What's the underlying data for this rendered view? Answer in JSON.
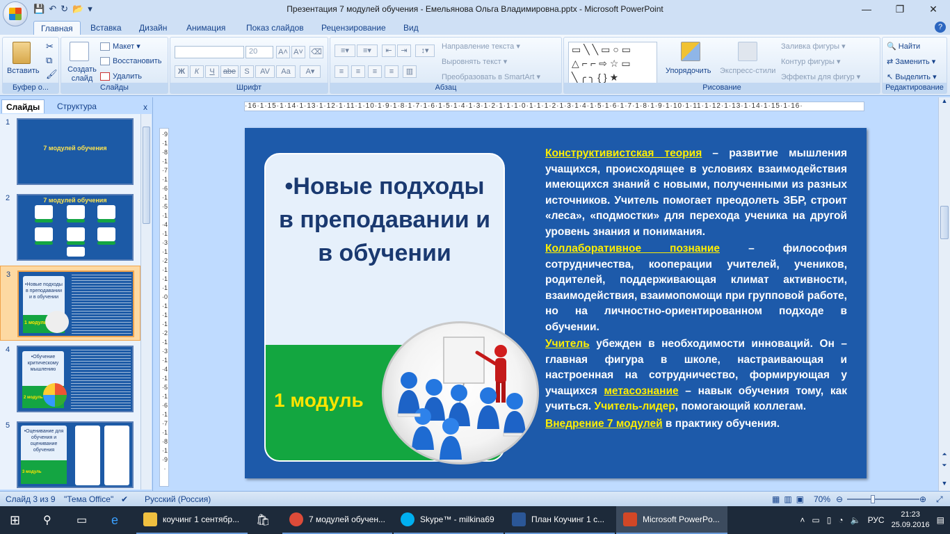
{
  "window": {
    "title": "Презентация 7 модулей обучения - Емельянова Ольга Владимировна.pptx - Microsoft PowerPoint",
    "minimize": "—",
    "maximize": "❐",
    "close": "✕"
  },
  "ribbon_tabs": [
    "Главная",
    "Вставка",
    "Дизайн",
    "Анимация",
    "Показ слайдов",
    "Рецензирование",
    "Вид"
  ],
  "ribbon": {
    "clipboard": {
      "paste": "Вставить",
      "label": "Буфер о..."
    },
    "slides": {
      "new_slide": "Создать слайд",
      "layout": "Макет",
      "reset": "Восстановить",
      "delete": "Удалить",
      "label": "Слайды"
    },
    "font": {
      "font_size": "20",
      "bold": "Ж",
      "italic": "К",
      "underline": "Ч",
      "strike": "abe",
      "shadow": "S",
      "spacing": "AV",
      "case": "Aa",
      "label": "Шрифт"
    },
    "paragraph": {
      "text_direction": "Направление текста",
      "align_text": "Выровнять текст",
      "smartart": "Преобразовать в SmartArt",
      "label": "Абзац"
    },
    "drawing": {
      "arrange": "Упорядочить",
      "quick_styles": "Экспресс-стили",
      "fill": "Заливка фигуры",
      "outline": "Контур фигуры",
      "effects": "Эффекты для фигур",
      "label": "Рисование"
    },
    "editing": {
      "find": "Найти",
      "replace": "Заменить",
      "select": "Выделить",
      "label": "Редактирование"
    }
  },
  "panel": {
    "tab_slides": "Слайды",
    "tab_outline": "Структура",
    "close": "x",
    "thumbnails": [
      {
        "num": "1",
        "title": "7 модулей обучения"
      },
      {
        "num": "2",
        "title": "7 модулей обучения"
      },
      {
        "num": "3",
        "title": "•Новые подходы в преподавании и в обучении",
        "module": "1 модуль"
      },
      {
        "num": "4",
        "title": "•Обучение критическому мышлению",
        "module": "2 модуль"
      },
      {
        "num": "5",
        "title": "•Оценивание для обучения и оценивание обучения",
        "module": "3 модуль"
      }
    ]
  },
  "ruler": {
    "horizontal": "·16·1·15·1·14·1·13·1·12·1·11·1·10·1·9·1·8·1·7·1·6·1·5·1·4·1·3·1·2·1·1·1·0·1·1·1·2·1·3·1·4·1·5·1·6·1·7·1·8·1·9·1·10·1·11·1·12·1·13·1·14·1·15·1·16·",
    "vertical": "·9·1·8·1·7·1·6·1·5·1·4·1·3·1·2·1·1·1·0·1·1·1·2·1·3·1·4·1·5·1·6·1·7·1·8·1·9·"
  },
  "slide": {
    "heading": "•Новые подходы в преподавании и в обучении",
    "module": "1 модуль",
    "p1_term": "Конструктивистская теория",
    "p1_text": " – развитие мышления учащихся, происходящее в условиях взаимодействия имеющихся знаний с новыми, полученными из разных источников. Учитель помогает преодолеть ЗБР, строит «леса», «подмостки» для перехода ученика на другой уровень знания и понимания.",
    "p2_term": "Коллаборативное познание",
    "p2_text": " – философия сотрудничества, кооперации учителей, учеников, родителей, поддерживающая климат активности, взаимодействия, взаимопомощи при групповой работе, но на личностно-ориентированном подходе в обучении.",
    "p3_term": "Учитель",
    "p3_text1": " убежден в необходимости инноваций. Он – главная фигура в школе, настраивающая и настроенная на сотрудничество, формирующая у учащихся ",
    "p3_term2": "метасознание",
    "p3_text2": " – навык обучения тому, как учиться. ",
    "p3_term3": "Учитель-лидер",
    "p3_text3": ", помогающий коллегам.",
    "p4_term": "Внедрение 7 модулей",
    "p4_text": " в практику обучения."
  },
  "status": {
    "slide_of": "Слайд 3 из 9",
    "theme": "\"Тема Office\"",
    "language": "Русский (Россия)",
    "zoom": "70%"
  },
  "taskbar": {
    "apps": [
      {
        "label": "коучинг 1 сентябр...",
        "color": "#f0c040"
      },
      {
        "label": "7 модулей обучен...",
        "color": "#dd4b39"
      },
      {
        "label": "Skype™ - milkina69",
        "color": "#00aff0"
      },
      {
        "label": "План Коучинг 1 с...",
        "color": "#2b5797"
      },
      {
        "label": "Microsoft PowerPo...",
        "color": "#d24726"
      }
    ],
    "lang": "РУС",
    "time": "21:23",
    "date": "25.09.2016"
  },
  "colors": {
    "slide_bg": "#1d5aaa",
    "accent_yellow": "#ffee00",
    "module_green": "#13a640",
    "ribbon_blue": "#15428b"
  }
}
